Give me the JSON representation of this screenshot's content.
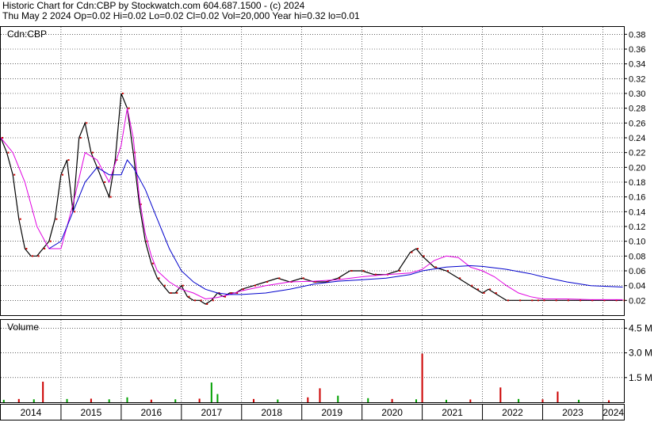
{
  "header": {
    "line1": "Historic Chart for Cdn:CBP by Stockwatch.com 604.687.1500 - (c) 2024",
    "line2": "Thu May  2 2024  Op=0.02  Hi=0.02  Lo=0.02  Cl=0.02  Vol=20,000  Year hi=0.32  lo=0.01"
  },
  "colors": {
    "price_bar": "#000000",
    "close_dot": "#cc0000",
    "ma_short": "#e000e0",
    "ma_long": "#0000cc",
    "volume_up": "#00a000",
    "volume_down": "#cc0000",
    "grid": "#000000"
  },
  "chart_data": [
    {
      "type": "line",
      "title": "Cdn:CBP",
      "y_ticks": [
        "0.02",
        "0.04",
        "0.06",
        "0.08",
        "0.10",
        "0.12",
        "0.14",
        "0.16",
        "0.18",
        "0.20",
        "0.22",
        "0.24",
        "0.26",
        "0.28",
        "0.30",
        "0.32",
        "0.34",
        "0.36",
        "0.38"
      ],
      "ylim": [
        0.0,
        0.39
      ],
      "x_ticks": [
        "2014",
        "2015",
        "2016",
        "2017",
        "2018",
        "2019",
        "2020",
        "2021",
        "2022",
        "2023",
        "2024"
      ],
      "xlim": [
        2014.0,
        2024.35
      ],
      "grid": true,
      "series": [
        {
          "key": "price",
          "x": [
            2014.0,
            2014.1,
            2014.2,
            2014.3,
            2014.4,
            2014.5,
            2014.6,
            2014.7,
            2014.8,
            2014.9,
            2015.0,
            2015.1,
            2015.2,
            2015.3,
            2015.4,
            2015.5,
            2015.6,
            2015.7,
            2015.8,
            2015.9,
            2016.0,
            2016.1,
            2016.2,
            2016.3,
            2016.4,
            2016.5,
            2016.6,
            2016.7,
            2016.8,
            2016.9,
            2017.0,
            2017.1,
            2017.2,
            2017.3,
            2017.4,
            2017.5,
            2017.6,
            2017.7,
            2017.8,
            2017.9,
            2018.0,
            2018.2,
            2018.4,
            2018.6,
            2018.8,
            2019.0,
            2019.2,
            2019.4,
            2019.6,
            2019.8,
            2020.0,
            2020.2,
            2020.4,
            2020.6,
            2020.8,
            2020.9,
            2021.0,
            2021.2,
            2021.4,
            2021.6,
            2021.8,
            2021.9,
            2022.0,
            2022.1,
            2022.2,
            2022.4,
            2022.6,
            2022.8,
            2022.9,
            2023.0,
            2023.2,
            2023.4,
            2023.6,
            2023.8,
            2024.0,
            2024.2,
            2024.33
          ],
          "values": [
            0.24,
            0.22,
            0.19,
            0.13,
            0.09,
            0.08,
            0.08,
            0.09,
            0.1,
            0.13,
            0.19,
            0.21,
            0.14,
            0.24,
            0.26,
            0.22,
            0.2,
            0.18,
            0.16,
            0.21,
            0.3,
            0.28,
            0.22,
            0.15,
            0.1,
            0.07,
            0.05,
            0.04,
            0.03,
            0.03,
            0.04,
            0.025,
            0.02,
            0.02,
            0.015,
            0.02,
            0.03,
            0.025,
            0.03,
            0.03,
            0.035,
            0.04,
            0.045,
            0.05,
            0.045,
            0.05,
            0.045,
            0.045,
            0.05,
            0.06,
            0.06,
            0.055,
            0.055,
            0.06,
            0.085,
            0.09,
            0.08,
            0.065,
            0.06,
            0.05,
            0.04,
            0.035,
            0.03,
            0.035,
            0.03,
            0.02,
            0.02,
            0.02,
            0.02,
            0.02,
            0.02,
            0.02,
            0.02,
            0.02,
            0.02,
            0.02,
            0.02
          ]
        },
        {
          "key": "ma_short",
          "x": [
            2014.0,
            2014.2,
            2014.4,
            2014.6,
            2014.8,
            2015.0,
            2015.2,
            2015.4,
            2015.6,
            2015.8,
            2016.0,
            2016.1,
            2016.2,
            2016.3,
            2016.4,
            2016.5,
            2016.6,
            2016.8,
            2017.0,
            2017.2,
            2017.4,
            2017.6,
            2017.8,
            2018.0,
            2018.4,
            2018.8,
            2019.2,
            2019.6,
            2020.0,
            2020.4,
            2020.8,
            2021.0,
            2021.2,
            2021.4,
            2021.6,
            2021.8,
            2022.0,
            2022.2,
            2022.4,
            2022.6,
            2022.8,
            2023.0,
            2023.4,
            2023.8,
            2024.33
          ],
          "values": [
            0.24,
            0.22,
            0.18,
            0.12,
            0.09,
            0.09,
            0.15,
            0.22,
            0.21,
            0.18,
            0.23,
            0.28,
            0.24,
            0.16,
            0.11,
            0.08,
            0.06,
            0.045,
            0.035,
            0.03,
            0.022,
            0.024,
            0.028,
            0.033,
            0.04,
            0.045,
            0.046,
            0.048,
            0.052,
            0.055,
            0.057,
            0.062,
            0.074,
            0.08,
            0.078,
            0.065,
            0.06,
            0.052,
            0.04,
            0.03,
            0.025,
            0.022,
            0.022,
            0.021,
            0.021
          ]
        },
        {
          "key": "ma_long",
          "x": [
            2014.8,
            2015.0,
            2015.2,
            2015.4,
            2015.6,
            2015.8,
            2016.0,
            2016.1,
            2016.2,
            2016.4,
            2016.6,
            2016.8,
            2017.0,
            2017.2,
            2017.4,
            2017.6,
            2017.8,
            2018.0,
            2018.4,
            2018.8,
            2019.2,
            2019.6,
            2020.0,
            2020.4,
            2020.8,
            2021.0,
            2021.4,
            2021.8,
            2022.0,
            2022.4,
            2022.8,
            2023.0,
            2023.4,
            2023.8,
            2024.33
          ],
          "values": [
            0.09,
            0.1,
            0.14,
            0.18,
            0.2,
            0.19,
            0.19,
            0.21,
            0.2,
            0.17,
            0.13,
            0.09,
            0.06,
            0.045,
            0.035,
            0.03,
            0.028,
            0.028,
            0.03,
            0.035,
            0.042,
            0.046,
            0.048,
            0.05,
            0.055,
            0.06,
            0.065,
            0.067,
            0.066,
            0.062,
            0.056,
            0.052,
            0.045,
            0.04,
            0.038
          ]
        }
      ]
    },
    {
      "type": "bar",
      "title": "Volume",
      "y_ticks": [
        "1.5 M",
        "3.0 M",
        "4.5 M"
      ],
      "ylim": [
        0,
        5000000
      ],
      "x": [
        2014.05,
        2014.3,
        2014.55,
        2014.7,
        2015.1,
        2015.5,
        2015.8,
        2016.1,
        2016.5,
        2016.9,
        2017.3,
        2017.5,
        2017.6,
        2018.2,
        2018.6,
        2019.1,
        2019.3,
        2019.6,
        2020.1,
        2020.5,
        2020.9,
        2021.0,
        2021.4,
        2021.8,
        2022.3,
        2022.6,
        2023.0,
        2023.25,
        2023.6,
        2024.1
      ],
      "values": [
        150000,
        200000,
        180000,
        1250000,
        200000,
        220000,
        180000,
        300000,
        160000,
        180000,
        220000,
        1200000,
        500000,
        200000,
        170000,
        300000,
        850000,
        400000,
        250000,
        200000,
        180000,
        2950000,
        150000,
        170000,
        900000,
        200000,
        180000,
        650000,
        150000,
        120000
      ],
      "up": [
        true,
        false,
        true,
        false,
        true,
        false,
        true,
        true,
        false,
        true,
        false,
        true,
        true,
        false,
        true,
        false,
        false,
        true,
        true,
        false,
        true,
        false,
        true,
        false,
        false,
        true,
        false,
        false,
        true,
        false
      ]
    }
  ]
}
